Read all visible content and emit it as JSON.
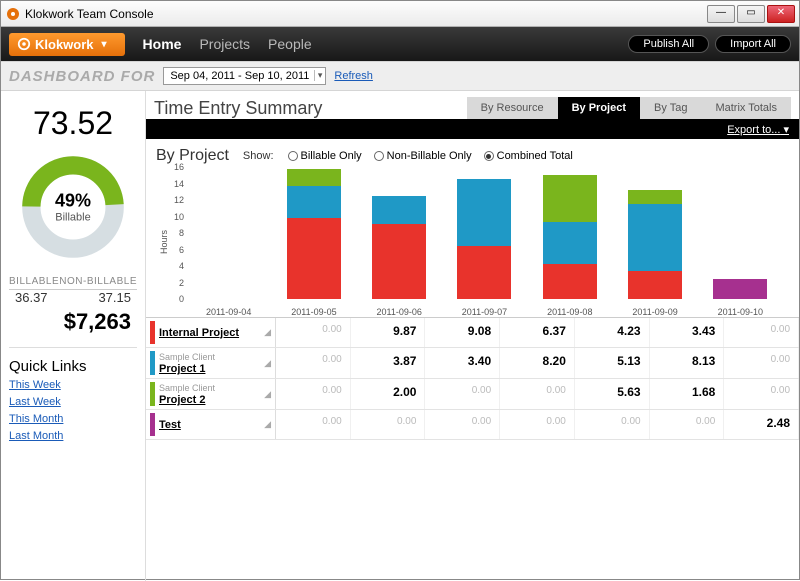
{
  "window": {
    "title": "Klokwork Team Console"
  },
  "brand": "Klokwork",
  "nav": {
    "home": "Home",
    "projects": "Projects",
    "people": "People"
  },
  "actions": {
    "publish": "Publish All",
    "import": "Import All"
  },
  "dashboard": {
    "label": "DASHBOARD FOR",
    "range": "Sep 04, 2011 - Sep 10, 2011",
    "refresh": "Refresh"
  },
  "summary": {
    "total_hours": "73.52",
    "billable_pct": "49%",
    "billable_label": "Billable",
    "billable_col": "BILLABLE",
    "nonbillable_col": "NON-BILLABLE",
    "billable_hours": "36.37",
    "nonbillable_hours": "37.15",
    "revenue": "$7,263"
  },
  "quicklinks": {
    "title": "Quick Links",
    "items": [
      "This Week",
      "Last Week",
      "This Month",
      "Last Month"
    ]
  },
  "tes": {
    "title": "Time Entry Summary",
    "tabs": [
      "By Resource",
      "By Project",
      "By Tag",
      "Matrix Totals"
    ],
    "active_tab": 1,
    "export": "Export to...",
    "section_title": "By Project",
    "show_label": "Show:",
    "filters": [
      "Billable Only",
      "Non-Billable Only",
      "Combined Total"
    ],
    "selected_filter": 2
  },
  "chart_data": {
    "type": "bar",
    "stacked": true,
    "ylabel": "Hours",
    "ylim": [
      0,
      16
    ],
    "yticks": [
      0,
      2,
      4,
      6,
      8,
      10,
      12,
      14,
      16
    ],
    "categories": [
      "2011-09-04",
      "2011-09-05",
      "2011-09-06",
      "2011-09-07",
      "2011-09-08",
      "2011-09-09",
      "2011-09-10"
    ],
    "colors": {
      "Internal Project": "#e8332c",
      "Project 1": "#1f99c6",
      "Project 2": "#7ab51d",
      "Test": "#a6308f"
    },
    "series": [
      {
        "name": "Internal Project",
        "values": [
          0,
          9.87,
          9.08,
          6.37,
          4.23,
          3.43,
          0
        ]
      },
      {
        "name": "Project 1",
        "values": [
          0,
          3.87,
          3.4,
          8.2,
          5.13,
          8.13,
          0
        ]
      },
      {
        "name": "Project 2",
        "values": [
          0,
          2.0,
          0,
          0,
          5.63,
          1.68,
          0
        ]
      },
      {
        "name": "Test",
        "values": [
          0,
          0,
          0,
          0,
          0,
          0,
          2.48
        ]
      }
    ]
  },
  "table": {
    "rows": [
      {
        "color": "#e8332c",
        "client": null,
        "name": "Internal Project",
        "cells": [
          "0.00",
          "9.87",
          "9.08",
          "6.37",
          "4.23",
          "3.43",
          "0.00"
        ]
      },
      {
        "color": "#1f99c6",
        "client": "Sample Client",
        "name": "Project 1",
        "cells": [
          "0.00",
          "3.87",
          "3.40",
          "8.20",
          "5.13",
          "8.13",
          "0.00"
        ]
      },
      {
        "color": "#7ab51d",
        "client": "Sample Client",
        "name": "Project 2",
        "cells": [
          "0.00",
          "2.00",
          "0.00",
          "0.00",
          "5.63",
          "1.68",
          "0.00"
        ]
      },
      {
        "color": "#a6308f",
        "client": null,
        "name": "Test",
        "cells": [
          "0.00",
          "0.00",
          "0.00",
          "0.00",
          "0.00",
          "0.00",
          "2.48"
        ]
      }
    ]
  }
}
